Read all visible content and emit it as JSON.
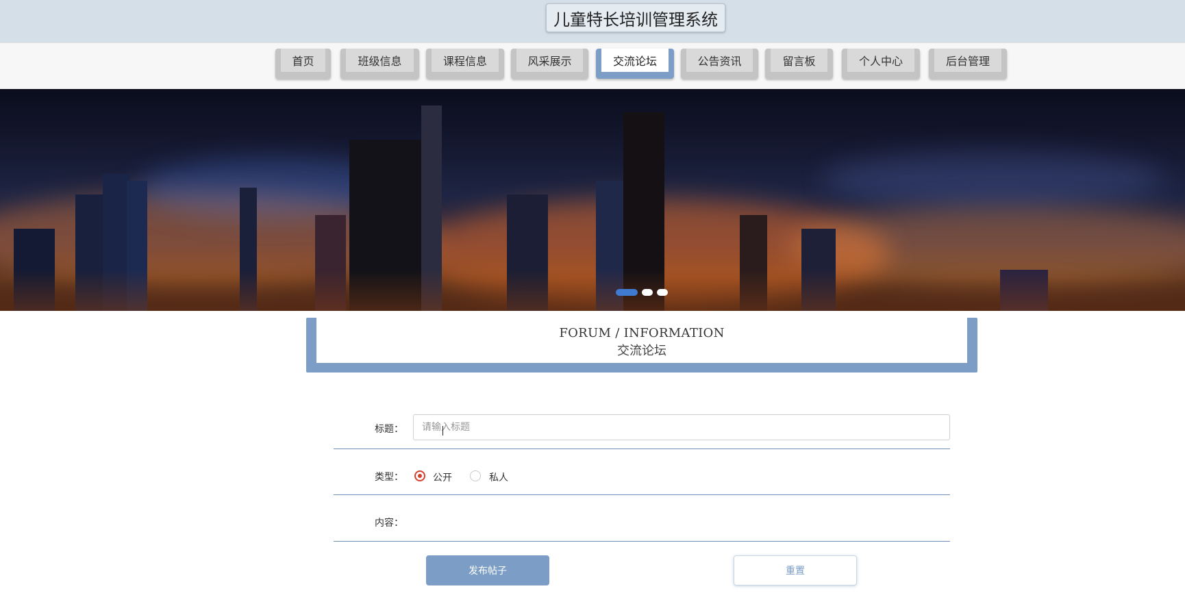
{
  "header": {
    "title": "儿童特长培训管理系统"
  },
  "nav": {
    "items": [
      {
        "label": "首页",
        "active": false
      },
      {
        "label": "班级信息",
        "active": false
      },
      {
        "label": "课程信息",
        "active": false
      },
      {
        "label": "风采展示",
        "active": false
      },
      {
        "label": "交流论坛",
        "active": true
      },
      {
        "label": "公告资讯",
        "active": false
      },
      {
        "label": "留言板",
        "active": false
      },
      {
        "label": "个人中心",
        "active": false
      },
      {
        "label": "后台管理",
        "active": false
      }
    ]
  },
  "banner": {
    "slide_count": 3,
    "active_slide": 1
  },
  "section": {
    "title_en": "FORUM / INFORMATION",
    "title_cn": "交流论坛"
  },
  "form": {
    "title_label": "标题：",
    "title_placeholder": "请输入标题",
    "title_value": "",
    "type_label": "类型：",
    "type_options": [
      "公开",
      "私人"
    ],
    "type_selected": "公开",
    "content_label": "内容：",
    "submit_label": "发布帖子",
    "reset_label": "重置"
  },
  "colors": {
    "accent": "#7b9dc6",
    "header_bg": "#d5dfe8",
    "radio_checked": "#d43f2e"
  }
}
